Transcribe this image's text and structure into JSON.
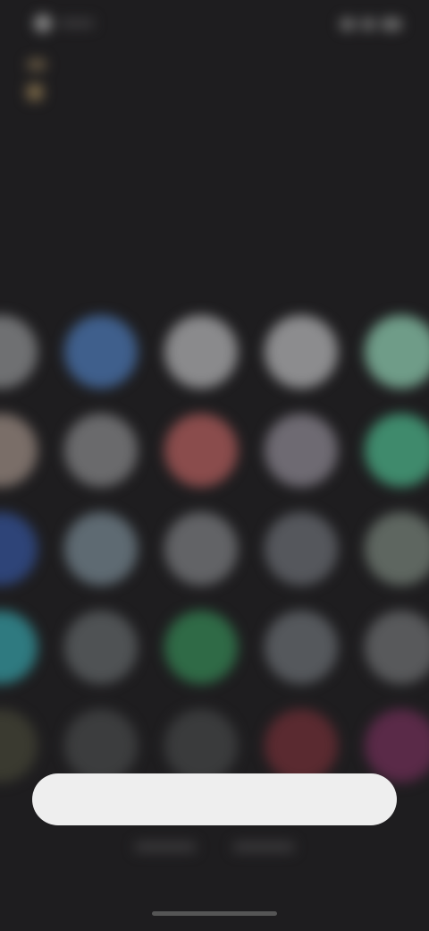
{
  "status_bar": {
    "left_icon": "location-icon",
    "right_icons": [
      "signal-icon",
      "wifi-icon",
      "battery-icon"
    ]
  },
  "header": {
    "back_icon": "back-icon",
    "account_icon": "account-icon",
    "account_label": ""
  },
  "title": {
    "line1": "",
    "line2": ""
  },
  "app_grid": {
    "rows": [
      [
        "#6f7072",
        "#3f5f8c",
        "#8a8a8c",
        "#8c8c8e",
        "#6f9c88"
      ],
      [
        "#7a6e68",
        "#6a6a6c",
        "#8a4c4c",
        "#6e6a72",
        "#3f8a6c"
      ],
      [
        "#2e4478",
        "#5e6a72",
        "#626366",
        "#55575c",
        "#5e6660"
      ],
      [
        "#2f7a80",
        "#4f5254",
        "#2f6a46",
        "#55585c",
        "#58595b"
      ],
      [
        "#3a3a30",
        "#3c3d3e",
        "#3a3b3c",
        "#5a2a30",
        "#5a2a48"
      ]
    ]
  },
  "primary_button": {
    "label": ""
  },
  "colors": {
    "background": "#1e1d1f",
    "button_bg": "#eeeeee",
    "accent": "#7a6848"
  }
}
